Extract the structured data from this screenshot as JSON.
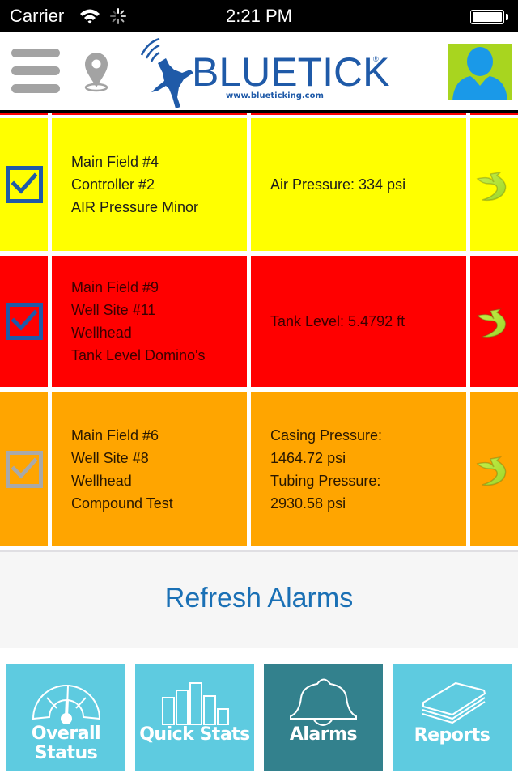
{
  "status_bar": {
    "carrier": "Carrier",
    "time": "2:21 PM",
    "battery_level": 1.0
  },
  "header": {
    "menu_icon": "hamburger-menu-icon",
    "location_icon": "map-pin-icon",
    "logo": {
      "brand": "BLUETICK",
      "registered": "®",
      "url": "www.blueticking.com"
    },
    "profile_icon": "user-avatar-icon"
  },
  "colors": {
    "yellow": "#ffff00",
    "red": "#ff0000",
    "orange": "#ffa500",
    "brand_blue": "#1f5aa8",
    "link_blue": "#1a70b5",
    "tab_bg": "#5ecbe0",
    "tab_active_bg": "#33818d",
    "avatar_bg": "#a8d51f"
  },
  "alarms": [
    {
      "severity": "yellow",
      "acknowledged": true,
      "location_lines": [
        "Main Field #4",
        "Controller #2",
        "AIR Pressure Minor"
      ],
      "value_lines": [
        "Air Pressure: 334 psi"
      ]
    },
    {
      "severity": "red",
      "acknowledged": true,
      "location_lines": [
        "Main Field #9",
        "Well Site #11",
        "Wellhead",
        "Tank Level Domino's"
      ],
      "value_lines": [
        "Tank Level: 5.4792 ft"
      ]
    },
    {
      "severity": "orange",
      "acknowledged": false,
      "location_lines": [
        "Main Field #6",
        "Well Site #8",
        "Wellhead",
        "Compound Test"
      ],
      "value_lines": [
        "Casing Pressure:",
        "1464.72 psi",
        "Tubing Pressure:",
        "2930.58 psi"
      ]
    }
  ],
  "refresh": {
    "label": "Refresh Alarms"
  },
  "tabs": [
    {
      "label_line1": "Overall",
      "label_line2": "Status",
      "icon": "gauge-icon",
      "active": false
    },
    {
      "label_line1": "Quick Stats",
      "label_line2": "",
      "icon": "bar-chart-icon",
      "active": false
    },
    {
      "label_line1": "Alarms",
      "label_line2": "",
      "icon": "bell-icon",
      "active": true
    },
    {
      "label_line1": "Reports",
      "label_line2": "",
      "icon": "papers-icon",
      "active": false
    }
  ]
}
